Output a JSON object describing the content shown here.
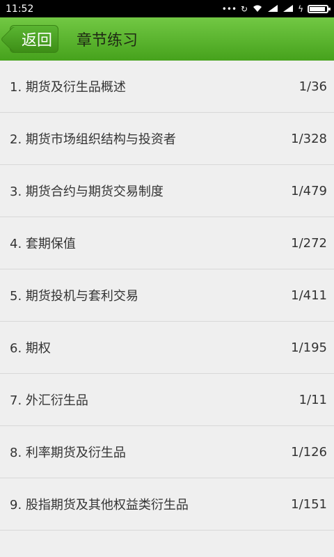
{
  "status_bar": {
    "time": "11:52",
    "icons": [
      "more-dots-icon",
      "sync-icon",
      "wifi-icon",
      "signal-icon",
      "signal-icon",
      "charging-icon",
      "battery-icon"
    ],
    "battery_level": 0.9
  },
  "header": {
    "back_label": "返回",
    "title": "章节练习",
    "accent_color": "#5cb82e"
  },
  "chapters": [
    {
      "title": "1. 期货及衍生品概述",
      "progress": "1/36"
    },
    {
      "title": "2. 期货市场组织结构与投资者",
      "progress": "1/328"
    },
    {
      "title": "3. 期货合约与期货交易制度",
      "progress": "1/479"
    },
    {
      "title": "4. 套期保值",
      "progress": "1/272"
    },
    {
      "title": "5. 期货投机与套利交易",
      "progress": "1/411"
    },
    {
      "title": "6. 期权",
      "progress": "1/195"
    },
    {
      "title": "7. 外汇衍生品",
      "progress": "1/11"
    },
    {
      "title": "8. 利率期货及衍生品",
      "progress": "1/126"
    },
    {
      "title": "9. 股指期货及其他权益类衍生品",
      "progress": "1/151"
    }
  ]
}
